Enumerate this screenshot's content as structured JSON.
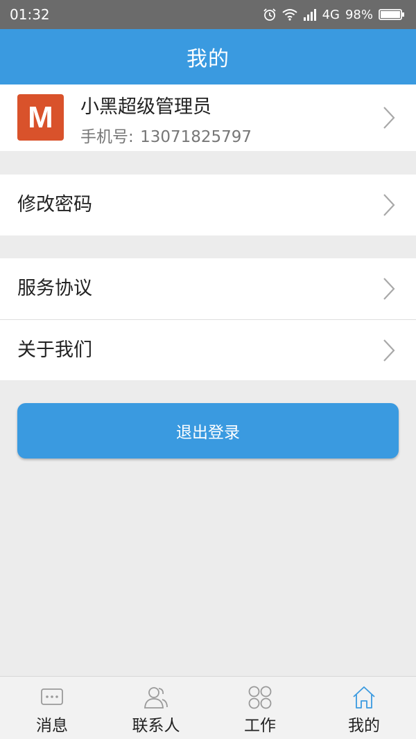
{
  "status_bar": {
    "time": "01:32",
    "network": "4G",
    "battery": "98%"
  },
  "header": {
    "title": "我的"
  },
  "profile": {
    "avatar_letter": "M",
    "name": "小黑超级管理员",
    "phone_label": "手机号:",
    "phone": "13071825797"
  },
  "menu": {
    "change_password": "修改密码",
    "service_agreement": "服务协议",
    "about_us": "关于我们"
  },
  "logout_label": "退出登录",
  "tabs": [
    {
      "label": "消息",
      "icon": "message-icon"
    },
    {
      "label": "联系人",
      "icon": "contacts-icon"
    },
    {
      "label": "工作",
      "icon": "work-grid-icon"
    },
    {
      "label": "我的",
      "icon": "home-icon",
      "active": true
    }
  ],
  "colors": {
    "primary": "#3a9ae0",
    "avatar": "#d9522b",
    "background": "#ececec"
  }
}
